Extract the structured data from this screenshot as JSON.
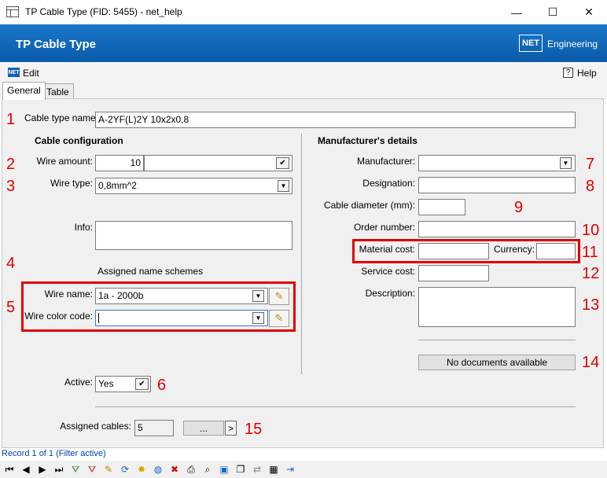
{
  "window": {
    "title": "TP Cable Type (FID: 5455) - net_help",
    "minimize": "—",
    "maximize": "☐",
    "close": "✕"
  },
  "header": {
    "title": "TP Cable Type",
    "logo_mark": "NET",
    "logo_text": "Engineering"
  },
  "menu": {
    "edit_icon": "NET",
    "edit": "Edit",
    "help_icon": "?",
    "help": "Help"
  },
  "tabs": [
    {
      "label": "General"
    },
    {
      "label": "Table"
    }
  ],
  "form": {
    "cable_type_name_label": "Cable type name:",
    "cable_type_name_value": "A-2YF(L)2Y 10x2x0,8",
    "cable_config_heading": "Cable configuration",
    "wire_amount_label": "Wire amount:",
    "wire_amount_value": "10",
    "wire_type_label": "Wire type:",
    "wire_type_value": "0,8mm^2",
    "info_label": "Info:",
    "info_value": "",
    "assigned_schemes_label": "Assigned name schemes",
    "wire_name_label": "Wire name:",
    "wire_name_value": "1a - 2000b",
    "wire_color_label": "Wire color code:",
    "wire_color_value": "",
    "active_label": "Active:",
    "active_value": "Yes",
    "assigned_cables_label": "Assigned cables:",
    "assigned_cables_value": "5",
    "assigned_cables_btn": "...",
    "assigned_cables_next": ">",
    "manufacturer_heading": "Manufacturer's details",
    "manufacturer_label": "Manufacturer:",
    "manufacturer_value": "",
    "designation_label": "Designation:",
    "designation_value": "",
    "cable_diameter_label": "Cable diameter (mm):",
    "cable_diameter_value": "",
    "order_number_label": "Order number:",
    "order_number_value": "",
    "material_cost_label": "Material cost:",
    "material_cost_value": "",
    "currency_label": "Currency:",
    "currency_value": "",
    "service_cost_label": "Service cost:",
    "service_cost_value": "",
    "description_label": "Description:",
    "description_value": "",
    "no_documents": "No documents available"
  },
  "callouts": [
    "1",
    "2",
    "3",
    "4",
    "5",
    "6",
    "7",
    "8",
    "9",
    "10",
    "11",
    "12",
    "13",
    "14",
    "15"
  ],
  "status": {
    "record": "Record 1 of 1 (Filter active)"
  },
  "toolbar": [
    {
      "icon": "first-record-icon",
      "glyph": "⏮"
    },
    {
      "icon": "prev-record-icon",
      "glyph": "◀"
    },
    {
      "icon": "next-record-icon",
      "glyph": "▶"
    },
    {
      "icon": "last-record-icon",
      "glyph": "⏭"
    },
    {
      "icon": "add-filter-icon",
      "glyph": "⛛"
    },
    {
      "icon": "remove-filter-icon",
      "glyph": "⛛"
    },
    {
      "icon": "edit-pencil-icon",
      "glyph": "✎"
    },
    {
      "icon": "refresh-icon",
      "glyph": "⟳"
    },
    {
      "icon": "new-record-icon",
      "glyph": "✸"
    },
    {
      "icon": "globe-icon",
      "glyph": "◍"
    },
    {
      "icon": "delete-icon",
      "glyph": "✖"
    },
    {
      "icon": "print-icon",
      "glyph": "⎙"
    },
    {
      "icon": "zoom-icon",
      "glyph": "⌕"
    },
    {
      "icon": "select-icon",
      "glyph": "▣"
    },
    {
      "icon": "copy-icon",
      "glyph": "❐"
    },
    {
      "icon": "link-icon",
      "glyph": "⇄"
    },
    {
      "icon": "table-icon",
      "glyph": "▦"
    },
    {
      "icon": "exit-icon",
      "glyph": "⇥"
    }
  ]
}
